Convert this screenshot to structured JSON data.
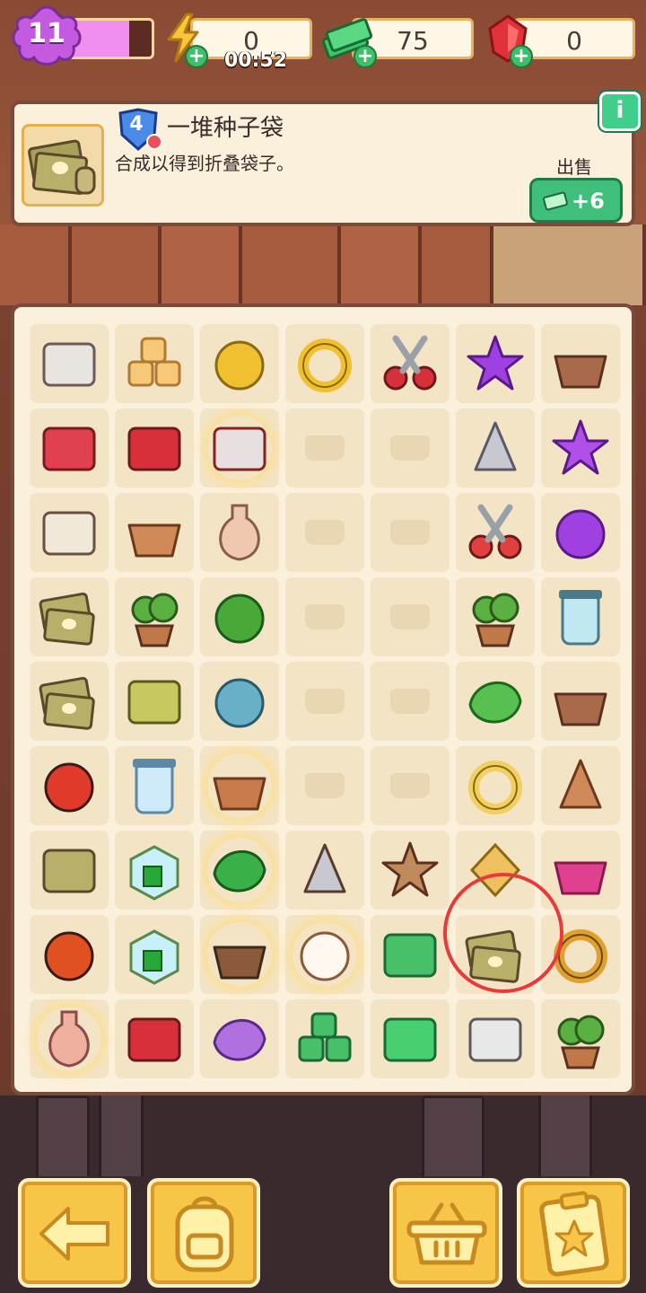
{
  "topbar": {
    "level": "11",
    "xp_fraction": 0.72,
    "energy": {
      "value": "0",
      "icon": "lightning-icon",
      "timer": "00:52"
    },
    "cash": {
      "value": "75",
      "icon": "cash-stack-icon"
    },
    "gems": {
      "value": "0",
      "icon": "ruby-gem-icon"
    }
  },
  "selected_item": {
    "level": "4",
    "name": "一堆种子袋",
    "description": "合成以得到折叠袋子。",
    "sell_label": "出售",
    "sell_value": "+6",
    "icon": "seed-bag-pile-icon"
  },
  "board": {
    "columns": 7,
    "rows": 9,
    "cells": [
      "zip-bag-icon",
      "cheese-cubes-icon",
      "gold-helmet-icon",
      "gold-hook-icon",
      "pruning-shears-icon",
      "purple-star-icon",
      "plant-mortar-icon",
      "red-box-icon",
      "red-toolbox-open-icon",
      "red-chest-icon",
      "empty",
      "empty",
      "trowel-icon",
      "purple-star-face-icon",
      "seed-poster-icon",
      "clay-pot-broken-icon",
      "glass-vase-icon",
      "empty",
      "empty",
      "red-scissors-icon",
      "purple-flower-face-icon",
      "seed-bag-pile-icon",
      "potted-herb-icon",
      "green-sponge-icon",
      "empty",
      "empty",
      "bonsai-tree-icon",
      "medicine-jar-icon",
      "seed-bags-icon",
      "seed-packet-icon",
      "blue-watering-can-icon",
      "empty",
      "empty",
      "sprout-leaves-icon",
      "mortar-flask-icon",
      "ladybug-icon",
      "ice-snow-globe-icon",
      "clay-pot-icon",
      "empty",
      "empty",
      "gold-ring-plate-icon",
      "pot-shard-icon",
      "seed-bag-icon",
      "glass-cube-icon",
      "green-cloth-icon",
      "hammer-icon",
      "cookie-leaf-icon",
      "diamond-gold-icon",
      "ruby-basket-icon",
      "ladybug-pair-icon",
      "glass-cube-2-icon",
      "pin-stump-icon",
      "lucky-cat-icon",
      "cash-bundle-icon",
      "seed-bag-pile-icon",
      "magnifier-icon",
      "pink-vase-icon",
      "red-toolbox-icon",
      "purple-moth-icon",
      "cash-pile-icon",
      "cash-bill-icon",
      "silver-box-icon",
      "flower-bush-icon"
    ]
  },
  "bottom_bar": {
    "back": "arrow-left-icon",
    "backpack": "backpack-icon",
    "basket": "basket-icon",
    "orders": "clipboard-star-icon"
  },
  "colors": {
    "panel": "#fbf0db",
    "border": "#7a4a3a",
    "accent_green": "#3fbf7a",
    "hint": "#e83a3a",
    "button_yellow": "#f7c648"
  }
}
